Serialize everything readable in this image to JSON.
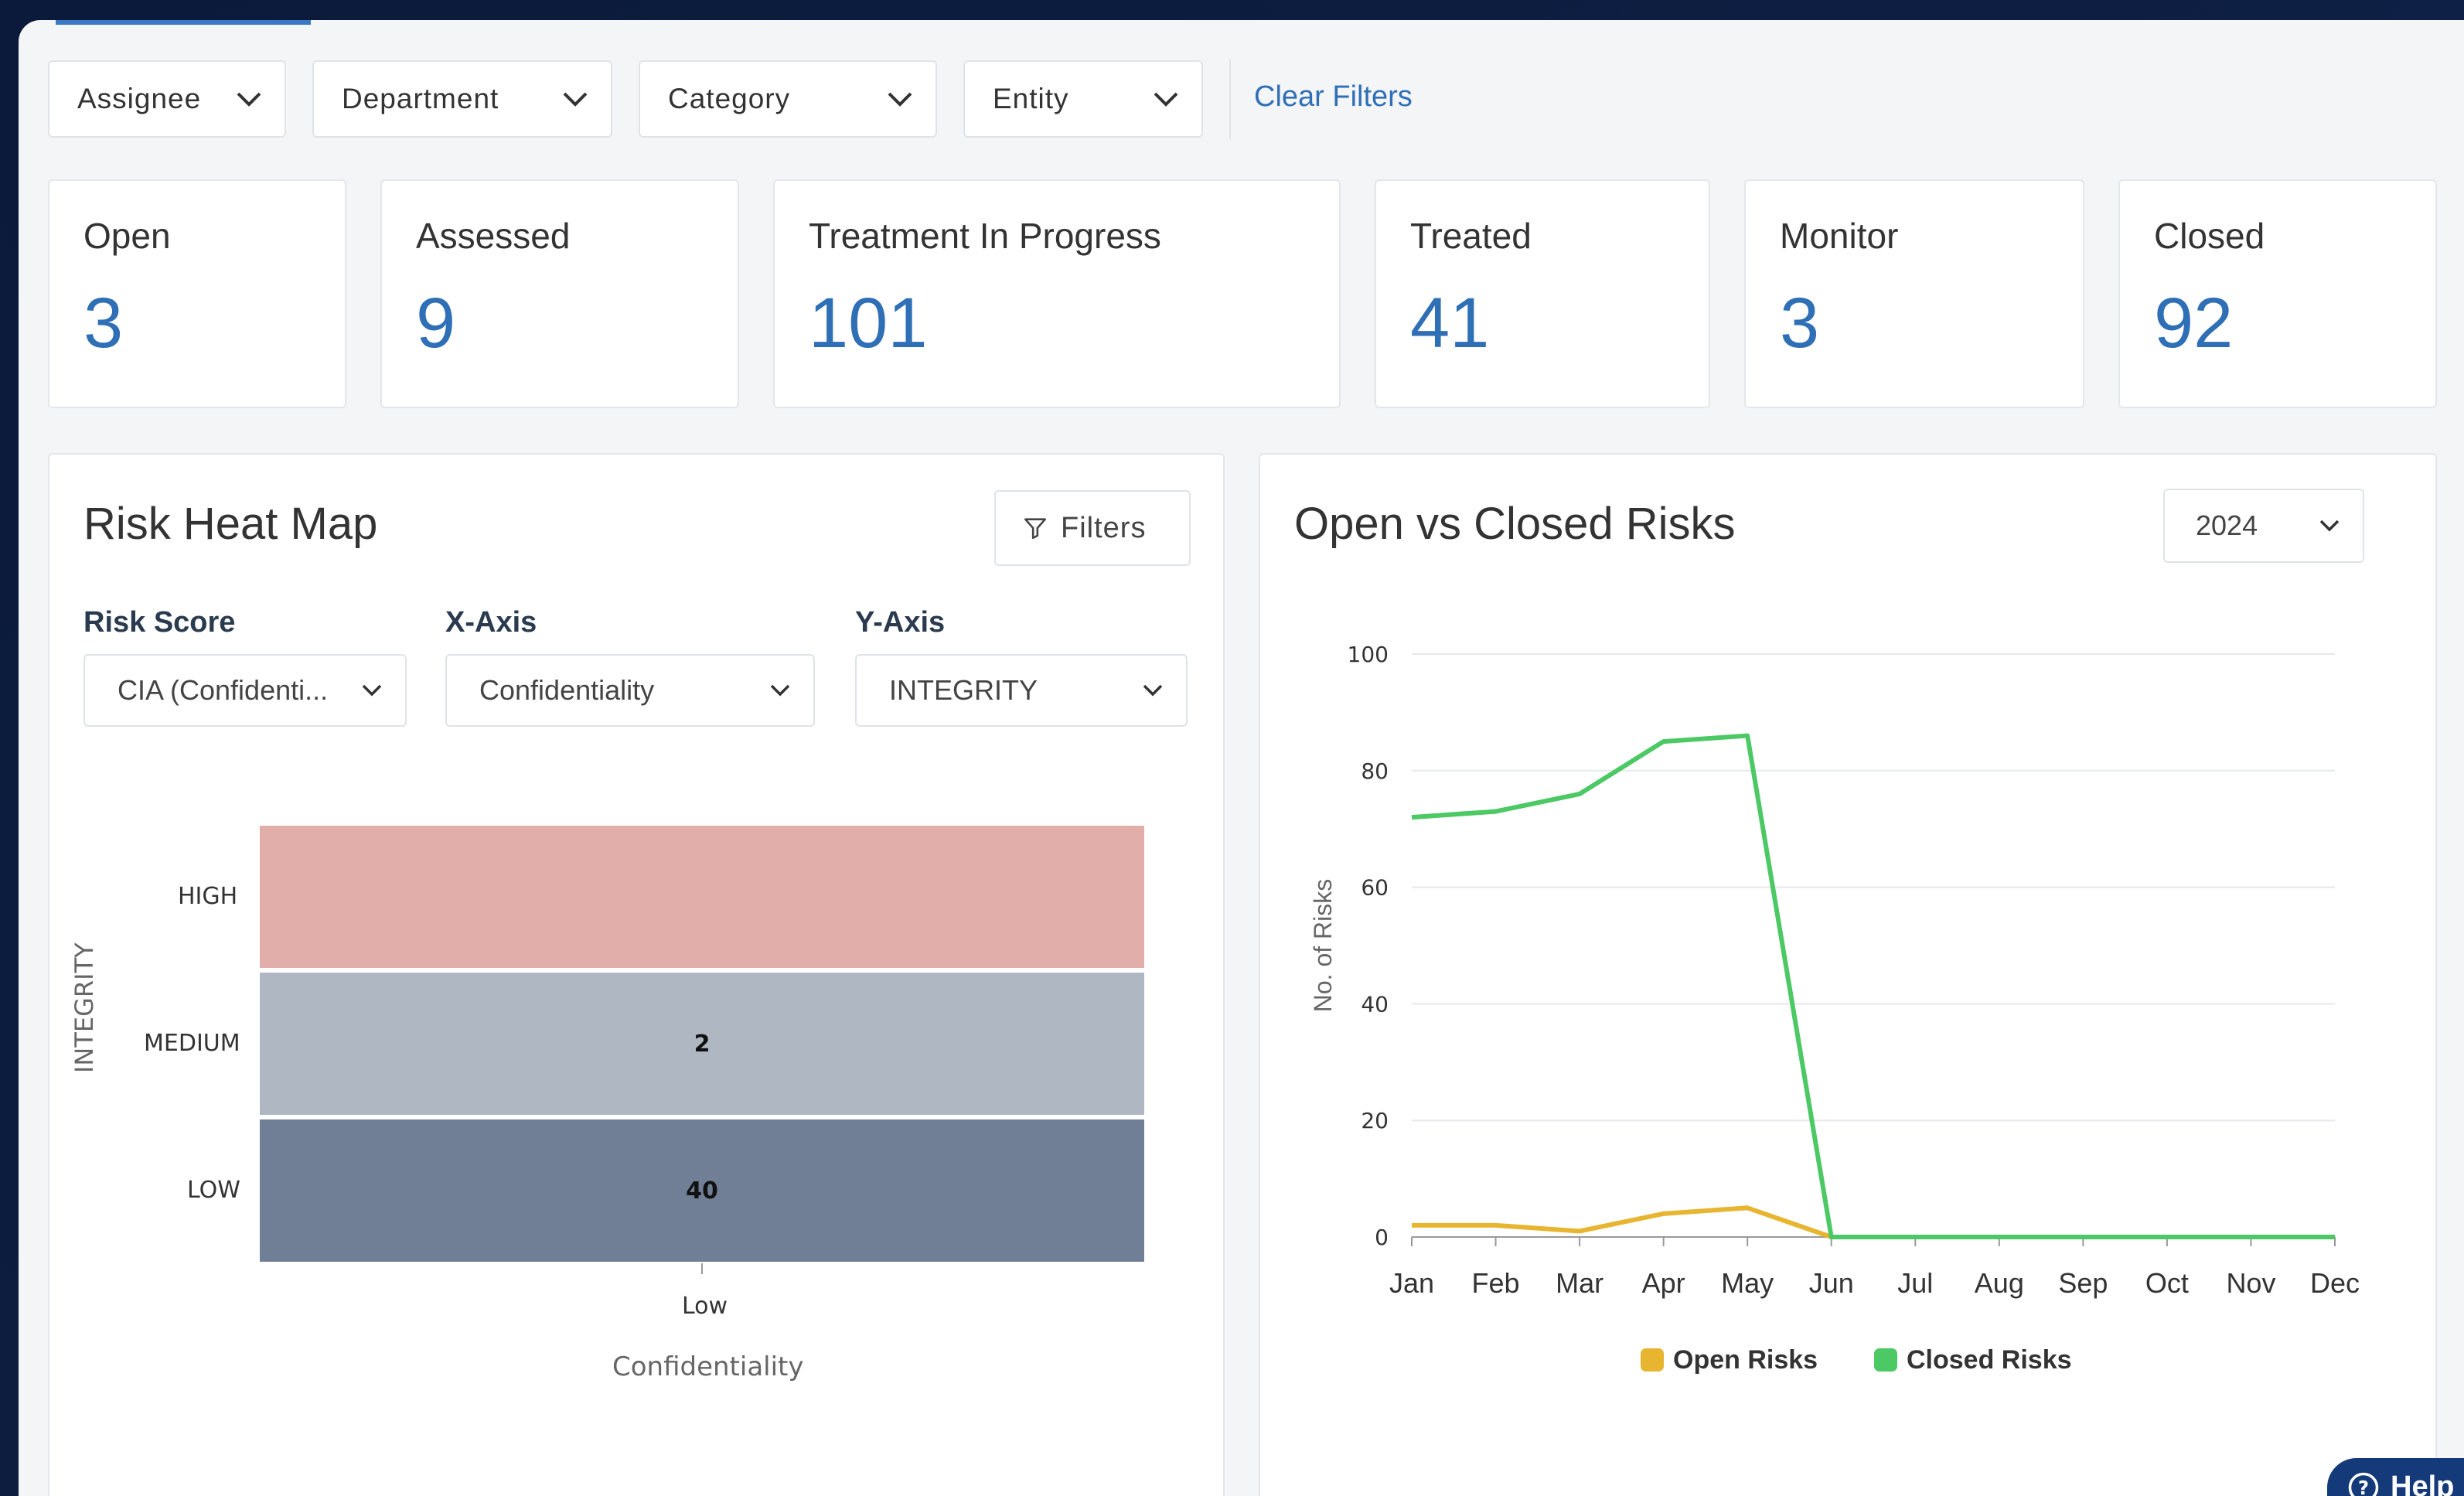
{
  "filters": {
    "assignee": "Assignee",
    "department": "Department",
    "category": "Category",
    "entity": "Entity",
    "clear": "Clear Filters"
  },
  "stats": [
    {
      "label": "Open",
      "value": "3"
    },
    {
      "label": "Assessed",
      "value": "9"
    },
    {
      "label": "Treatment In Progress",
      "value": "101"
    },
    {
      "label": "Treated",
      "value": "41"
    },
    {
      "label": "Monitor",
      "value": "3"
    },
    {
      "label": "Closed",
      "value": "92"
    }
  ],
  "heatmap": {
    "title": "Risk Heat Map",
    "filters_button": "Filters",
    "risk_score_label": "Risk Score",
    "risk_score_value": "CIA (Confidenti...",
    "x_axis_label": "X-Axis",
    "x_axis_value": "Confidentiality",
    "y_axis_label": "Y-Axis",
    "y_axis_value": "INTEGRITY",
    "y_title": "INTEGRITY",
    "x_title": "Confidentiality",
    "x_category": "Low",
    "rows": [
      {
        "label": "HIGH",
        "value": "",
        "color": "#e2aea9"
      },
      {
        "label": "MEDIUM",
        "value": "2",
        "color": "#afb7c3"
      },
      {
        "label": "LOW",
        "value": "40",
        "color": "#707f96"
      }
    ]
  },
  "linechart": {
    "title": "Open vs Closed Risks",
    "year": "2024"
  },
  "chart_data": {
    "type": "line",
    "title": "Open vs Closed Risks",
    "xlabel": "",
    "ylabel": "No. of Risks",
    "categories": [
      "Jan",
      "Feb",
      "Mar",
      "Apr",
      "May",
      "Jun",
      "Jul",
      "Aug",
      "Sep",
      "Oct",
      "Nov",
      "Dec"
    ],
    "ylim": [
      0,
      100
    ],
    "yticks": [
      0,
      20,
      40,
      60,
      80,
      100
    ],
    "grid": true,
    "legend": "bottom",
    "series": [
      {
        "name": "Open Risks",
        "color": "#e7b530",
        "values": [
          2,
          2,
          1,
          4,
          5,
          0,
          0,
          0,
          0,
          0,
          0,
          0
        ]
      },
      {
        "name": "Closed Risks",
        "color": "#4cc964",
        "values": [
          72,
          73,
          76,
          85,
          86,
          0,
          0,
          0,
          0,
          0,
          0,
          0
        ]
      }
    ]
  },
  "help": "Help"
}
